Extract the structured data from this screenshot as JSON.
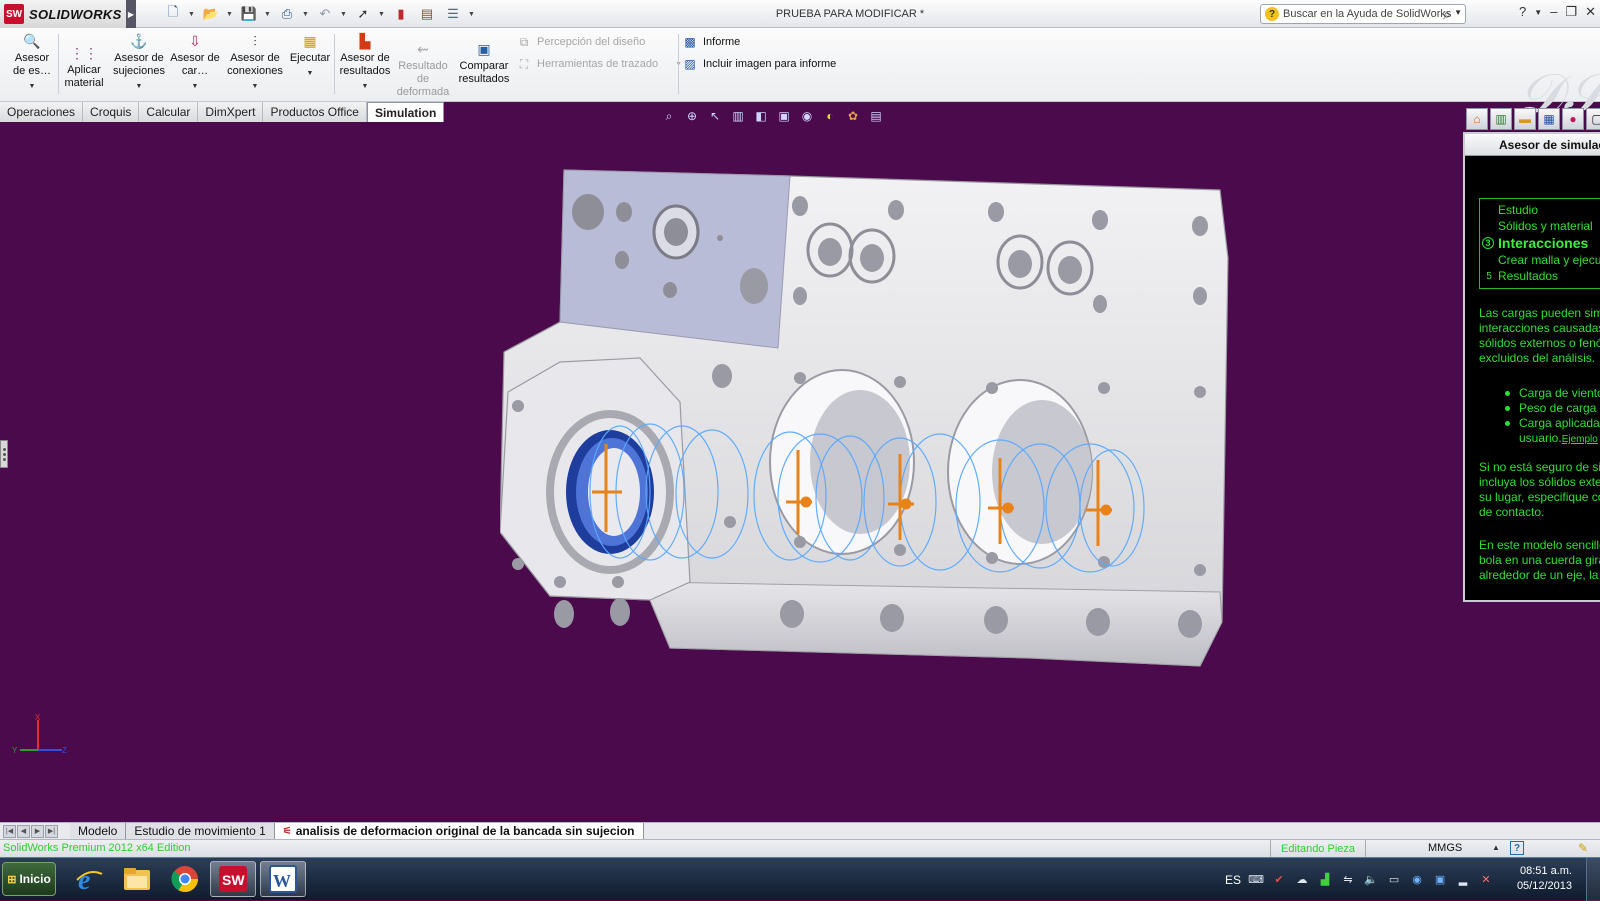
{
  "app": {
    "brand": "SOLIDWORKS",
    "brand_mark": "SW",
    "document_title": "PRUEBA PARA MODIFICAR *"
  },
  "help_search": {
    "placeholder": "Buscar en la Ayuda de SolidWorks"
  },
  "ribbon": {
    "buttons": [
      {
        "id": "asesor-estudio",
        "label": "Asesor de es…",
        "icon": "study-advisor-icon"
      },
      {
        "id": "aplicar-material",
        "label": "Aplicar material",
        "icon": "material-icon"
      },
      {
        "id": "asesor-sujeciones",
        "label": "Asesor de sujeciones",
        "icon": "fixture-icon"
      },
      {
        "id": "asesor-cargas",
        "label": "Asesor de car…",
        "icon": "load-icon"
      },
      {
        "id": "asesor-conexiones",
        "label": "Asesor de conexiones",
        "icon": "connection-icon"
      },
      {
        "id": "ejecutar",
        "label": "Ejecutar",
        "icon": "run-icon"
      },
      {
        "id": "asesor-resultados",
        "label": "Asesor de resultados",
        "icon": "results-icon"
      },
      {
        "id": "resultado-deformada",
        "label": "Resultado de deformada",
        "icon": "deformed-icon",
        "disabled": true
      },
      {
        "id": "comparar-resultados",
        "label": "Comparar resultados",
        "icon": "compare-icon"
      }
    ],
    "small": {
      "percepcion": "Percepción del diseño",
      "herramientas": "Herramientas de trazado",
      "informe": "Informe",
      "incluir": "Incluir imagen para informe"
    }
  },
  "tabs": [
    "Operaciones",
    "Croquis",
    "Calcular",
    "DimXpert",
    "Productos Office",
    "Simulation"
  ],
  "active_tab": "Simulation",
  "task_pane": {
    "title": "Asesor de simulación",
    "steps": [
      {
        "num": "",
        "label": "Estudio"
      },
      {
        "num": "",
        "label": "Sólidos y material"
      },
      {
        "num": "3",
        "label": "Interacciones",
        "current": true
      },
      {
        "num": "",
        "label": "Crear malla y ejecutar"
      },
      {
        "num": "5",
        "label": "Resultados"
      }
    ],
    "para1": [
      "Las cargas pueden simularse como",
      "interacciones causadas por",
      "sólidos externos o fenómenos",
      "excluidos del análisis."
    ],
    "bullets": [
      "Carga de viento",
      "Peso de carga",
      "Carga aplicada por el",
      "usuario."
    ],
    "bullet_link": "Ejemplo",
    "para2": [
      "Si no está seguro de si",
      "incluya los sólidos externos. En",
      "su lugar, especifique condiciones",
      "de contacto."
    ],
    "para3": [
      "En este modelo sencillo de una",
      "bola en una cuerda girando",
      "alrededor de un eje, la"
    ]
  },
  "bottom_tabs": [
    "Modelo",
    "Estudio de movimiento 1",
    "analisis de deformacion original de la bancada sin sujecion"
  ],
  "status": {
    "edition": "SolidWorks Premium 2012 x64 Edition",
    "editing": "Editando Pieza",
    "units": "MMGS"
  },
  "taskbar": {
    "start": "Inicio",
    "apps": [
      "internet-explorer-icon",
      "file-explorer-icon",
      "chrome-icon",
      "solidworks-icon",
      "word-icon"
    ],
    "language": "ES",
    "time": "08:51 a.m.",
    "date": "05/12/2013"
  },
  "colors": {
    "viewport": "#4b0a4b",
    "pane_text": "#2ee02e",
    "load_arrows": "#e8831a",
    "mesh_lines": "#5aa9ff"
  }
}
